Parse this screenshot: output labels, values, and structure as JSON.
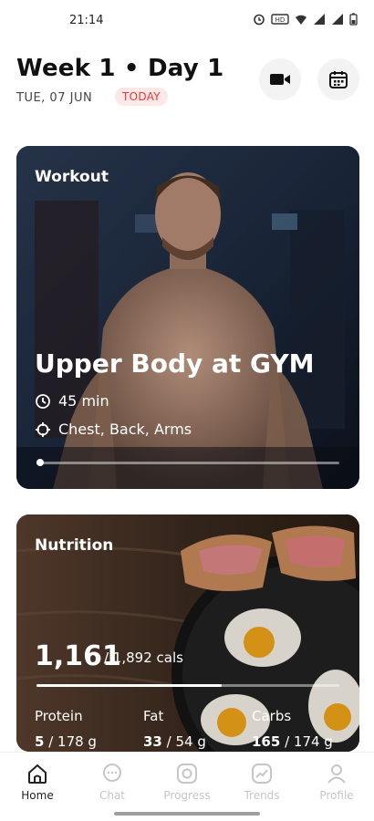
{
  "status_bar": {
    "time": "21:14",
    "icons": [
      "alarm-icon",
      "hd-icon",
      "wifi-icon",
      "signal-icon",
      "signal-icon",
      "battery-icon"
    ]
  },
  "header": {
    "title": "Week 1 • Day 1",
    "date": "TUE, 07 JUN",
    "badge": "TODAY",
    "video_icon": "video-camera-icon",
    "calendar_icon": "calendar-icon"
  },
  "workout": {
    "label": "Workout",
    "title": "Upper Body at GYM",
    "duration": "45 min",
    "muscles": "Chest, Back, Arms",
    "progress": 0.0
  },
  "nutrition": {
    "label": "Nutrition",
    "calories": "1,161",
    "calories_goal": "/ 1,892 cals",
    "progress": 0.61,
    "macros": [
      {
        "name": "Protein",
        "value": "5",
        "goal": " / 178 g"
      },
      {
        "name": "Fat",
        "value": "33",
        "goal": " / 54 g"
      },
      {
        "name": "Carbs",
        "value": "165",
        "goal": " / 174 g"
      }
    ]
  },
  "nav": [
    {
      "label": "Home",
      "icon": "home-icon",
      "active": true
    },
    {
      "label": "Chat",
      "icon": "chat-icon",
      "active": false
    },
    {
      "label": "Progress",
      "icon": "camera-icon",
      "active": false
    },
    {
      "label": "Trends",
      "icon": "trends-icon",
      "active": false
    },
    {
      "label": "Profile",
      "icon": "profile-icon",
      "active": false
    }
  ],
  "colors": {
    "accent": "#e53935",
    "badge_bg": "#fde8e8",
    "nav_inactive": "#c6c6c6"
  }
}
